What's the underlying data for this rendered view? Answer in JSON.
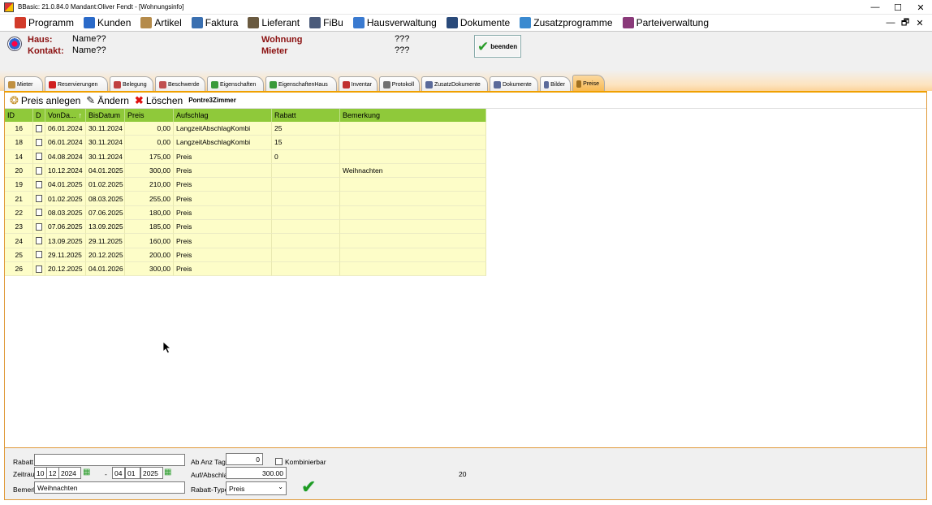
{
  "window": {
    "title": "BBasic: 21.0.84.0 Mandant:Oliver Fendt  - [Wohnungsinfo]",
    "controls": [
      "—",
      "☐",
      "✕"
    ]
  },
  "menu": {
    "items": [
      {
        "label": "Programm",
        "icon": "programm-icon",
        "color": "#d23b2a"
      },
      {
        "label": "Kunden",
        "icon": "kunden-icon",
        "color": "#2a6ac9"
      },
      {
        "label": "Artikel",
        "icon": "artikel-icon",
        "color": "#b58b4a"
      },
      {
        "label": "Faktura",
        "icon": "faktura-icon",
        "color": "#3a6fb0"
      },
      {
        "label": "Lieferant",
        "icon": "lieferant-icon",
        "color": "#6a5a40"
      },
      {
        "label": "FiBu",
        "icon": "fibu-icon",
        "color": "#4a5a7a"
      },
      {
        "label": "Hausverwaltung",
        "icon": "hausverwaltung-icon",
        "color": "#3a7ad0"
      },
      {
        "label": "Dokumente",
        "icon": "dokumente-icon",
        "color": "#2a4a7a"
      },
      {
        "label": "Zusatzprogramme",
        "icon": "zusatzprogramme-icon",
        "color": "#3a8ad0"
      },
      {
        "label": "Parteiverwaltung",
        "icon": "parteiverwaltung-icon",
        "color": "#8a3a7a"
      }
    ],
    "mdi_controls": [
      "—",
      "🗗",
      "✕"
    ]
  },
  "info": {
    "haus_label": "Haus:",
    "haus_value": "Name??",
    "kontakt_label": "Kontakt:",
    "kontakt_value": "Name??",
    "wohnung_label": "Wohnung",
    "wohnung_value": "???",
    "mieter_label": "Mieter",
    "mieter_value": "???",
    "beenden_label": "beenden"
  },
  "tabs": [
    {
      "label": "Mieter",
      "icon": "mieter-icon",
      "color": "#c09040",
      "width": 48
    },
    {
      "label": "Reservierungen",
      "icon": "reservierungen-icon",
      "color": "#d02020",
      "width": 78
    },
    {
      "label": "Belegung",
      "icon": "belegung-icon",
      "color": "#c04040",
      "width": 54
    },
    {
      "label": "Beschwerde",
      "icon": "beschwerde-icon",
      "color": "#c05050",
      "width": 62
    },
    {
      "label": "Eigenschaften",
      "icon": "eigenschaften-icon",
      "color": "#3a9a3a",
      "width": 70
    },
    {
      "label": "EigenschaftenHaus",
      "icon": "eigenschaftenhaus-icon",
      "color": "#3a9a3a",
      "width": 88
    },
    {
      "label": "Inventar",
      "icon": "inventar-icon",
      "color": "#c03030",
      "width": 48
    },
    {
      "label": "Protokoll",
      "icon": "protokoll-icon",
      "color": "#707070",
      "width": 50
    },
    {
      "label": "ZusatzDokumente",
      "icon": "zusatzdokumente-icon",
      "color": "#5a6a9a",
      "width": 82
    },
    {
      "label": "Dokumente",
      "icon": "dokumente-tab-icon",
      "color": "#5a6a9a",
      "width": 60
    },
    {
      "label": "Bilder",
      "icon": "bilder-icon",
      "color": "#5a6a9a",
      "width": 38
    },
    {
      "label": "Preise",
      "icon": "preise-icon",
      "color": "#a07020",
      "width": 40,
      "active": true
    }
  ],
  "toolbar": {
    "preis_anlegen": "Preis anlegen",
    "aendern": "Ändern",
    "loeschen": "Löschen",
    "reference": "Pontre3Zimmer"
  },
  "table": {
    "columns": [
      {
        "label": "ID",
        "width": 35
      },
      {
        "label": "D",
        "width": 15
      },
      {
        "label": "VonDa...",
        "width": 50,
        "sort": "↑"
      },
      {
        "label": "BisDatum",
        "width": 48
      },
      {
        "label": "Preis",
        "width": 60
      },
      {
        "label": "Aufschlag",
        "width": 121
      },
      {
        "label": "Rabatt",
        "width": 84
      },
      {
        "label": "Bemerkung",
        "width": 180
      }
    ],
    "rows": [
      {
        "id": "16",
        "von": "06.01.2024",
        "bis": "30.11.2024",
        "preis": "0,00",
        "aufschlag": "LangzeitAbschlagKombi",
        "rabatt": "25",
        "bemerkung": ""
      },
      {
        "id": "18",
        "von": "06.01.2024",
        "bis": "30.11.2024",
        "preis": "0,00",
        "aufschlag": "LangzeitAbschlagKombi",
        "rabatt": "15",
        "bemerkung": ""
      },
      {
        "id": "14",
        "von": "04.08.2024",
        "bis": "30.11.2024",
        "preis": "175,00",
        "aufschlag": "Preis",
        "rabatt": "0",
        "bemerkung": ""
      },
      {
        "id": "20",
        "von": "10.12.2024",
        "bis": "04.01.2025",
        "preis": "300,00",
        "aufschlag": "Preis",
        "rabatt": "",
        "bemerkung": "Weihnachten"
      },
      {
        "id": "19",
        "von": "04.01.2025",
        "bis": "01.02.2025",
        "preis": "210,00",
        "aufschlag": "Preis",
        "rabatt": "",
        "bemerkung": ""
      },
      {
        "id": "21",
        "von": "01.02.2025",
        "bis": "08.03.2025",
        "preis": "255,00",
        "aufschlag": "Preis",
        "rabatt": "",
        "bemerkung": ""
      },
      {
        "id": "22",
        "von": "08.03.2025",
        "bis": "07.06.2025",
        "preis": "180,00",
        "aufschlag": "Preis",
        "rabatt": "",
        "bemerkung": ""
      },
      {
        "id": "23",
        "von": "07.06.2025",
        "bis": "13.09.2025",
        "preis": "185,00",
        "aufschlag": "Preis",
        "rabatt": "",
        "bemerkung": ""
      },
      {
        "id": "24",
        "von": "13.09.2025",
        "bis": "29.11.2025",
        "preis": "160,00",
        "aufschlag": "Preis",
        "rabatt": "",
        "bemerkung": ""
      },
      {
        "id": "25",
        "von": "29.11.2025",
        "bis": "20.12.2025",
        "preis": "200,00",
        "aufschlag": "Preis",
        "rabatt": "",
        "bemerkung": ""
      },
      {
        "id": "26",
        "von": "20.12.2025",
        "bis": "04.01.2026",
        "preis": "300,00",
        "aufschlag": "Preis",
        "rabatt": "",
        "bemerkung": ""
      }
    ]
  },
  "edit": {
    "rabatt_label": "Rabatt",
    "rabatt_value": "",
    "zeitraum_label": "Zeitraum",
    "von_tag": "10",
    "von_monat": "12",
    "von_jahr": "2024",
    "separator": "-",
    "bis_tag": "04",
    "bis_monat": "01",
    "bis_jahr": "2025",
    "bemerk_label": "Bemerk",
    "bemerk_value": "Weihnachten",
    "ab_anz_tage_label": "Ab Anz Tage",
    "ab_anz_tage_value": "0",
    "kombinierbar_label": "Kombinierbar",
    "auf_abschlag_label": "Auf/Abschlag",
    "auf_abschlag_value": "300.00",
    "rabatt_type_label": "Rabatt-Type",
    "rabatt_type_value": "Preis",
    "record_id": "20"
  },
  "colors": {
    "header_green": "#8fc93a",
    "row_yellow": "#fdfdc8",
    "label_red": "#8b1010",
    "accent_orange": "#f0a000"
  }
}
